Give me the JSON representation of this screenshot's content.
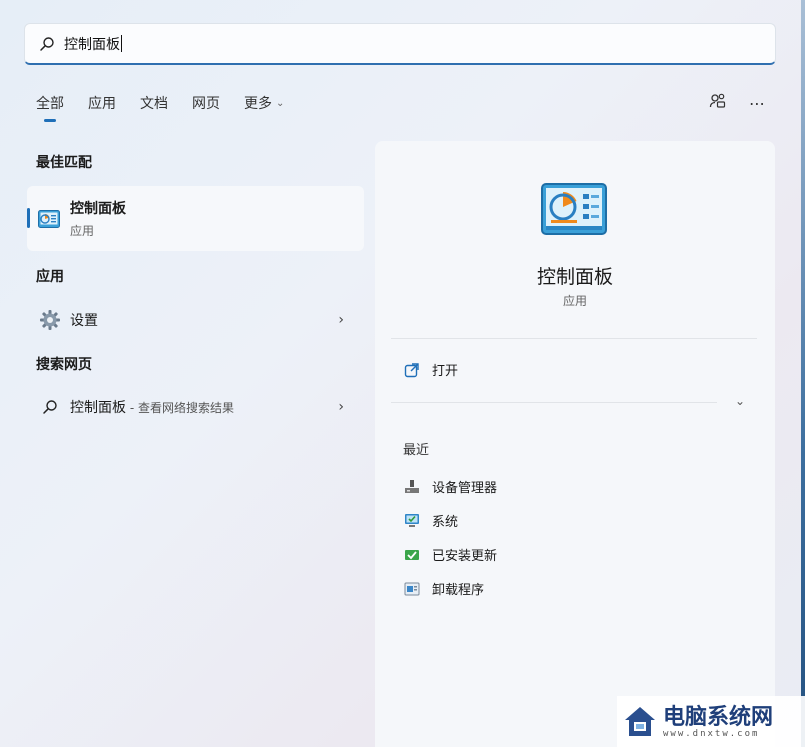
{
  "search": {
    "value": "控制面板"
  },
  "tabs": [
    {
      "label": "全部"
    },
    {
      "label": "应用"
    },
    {
      "label": "文档"
    },
    {
      "label": "网页"
    },
    {
      "label": "更多"
    }
  ],
  "left": {
    "best_match_title": "最佳匹配",
    "best_match": {
      "title": "控制面板",
      "subtitle": "应用"
    },
    "apps_title": "应用",
    "apps": [
      {
        "label": "设置"
      }
    ],
    "web_title": "搜索网页",
    "web": {
      "query": "控制面板",
      "suffix": " - 查看网络搜索结果"
    }
  },
  "panel": {
    "title": "控制面板",
    "subtitle": "应用",
    "open_label": "打开",
    "recent_title": "最近",
    "recent": [
      {
        "label": "设备管理器",
        "icon": "device-manager-icon"
      },
      {
        "label": "系统",
        "icon": "system-icon"
      },
      {
        "label": "已安装更新",
        "icon": "installed-updates-icon"
      },
      {
        "label": "卸载程序",
        "icon": "uninstall-program-icon"
      }
    ]
  },
  "watermark": {
    "title": "电脑系统网",
    "url": "www.dnxtw.com"
  },
  "colors": {
    "accent": "#1f6fb8"
  }
}
